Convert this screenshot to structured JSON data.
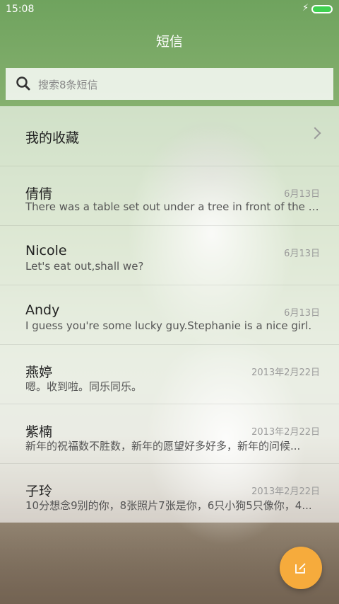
{
  "status_bar": {
    "time": "15:08",
    "charging_icon": "bolt-icon"
  },
  "header": {
    "title": "短信"
  },
  "search": {
    "placeholder": "搜索8条短信"
  },
  "favorites": {
    "label": "我的收藏"
  },
  "threads": [
    {
      "name": "倩倩",
      "date": "6月13日",
      "snippet": "There was a table set out under a tree in front of the ho..."
    },
    {
      "name": "Nicole",
      "date": "6月13日",
      "snippet": "Let's eat out,shall we?"
    },
    {
      "name": "Andy",
      "date": "6月13日",
      "snippet": "I guess you're some lucky guy.Stephanie is a nice girl."
    },
    {
      "name": "燕婷",
      "date": "2013年2月22日",
      "snippet": "嗯。收到啦。同乐同乐。"
    },
    {
      "name": "紫楠",
      "date": "2013年2月22日",
      "snippet": "新年的祝福数不胜数，新年的愿望好多好多，新年的问候..."
    },
    {
      "name": "子玲",
      "date": "2013年2月22日",
      "snippet": "10分想念9别的你，8张照片7张是你，6只小狗5只像你，4..."
    }
  ],
  "fab": {
    "icon": "compose-icon"
  },
  "colors": {
    "accent": "#f6ab3c",
    "battery": "#3fd150"
  }
}
